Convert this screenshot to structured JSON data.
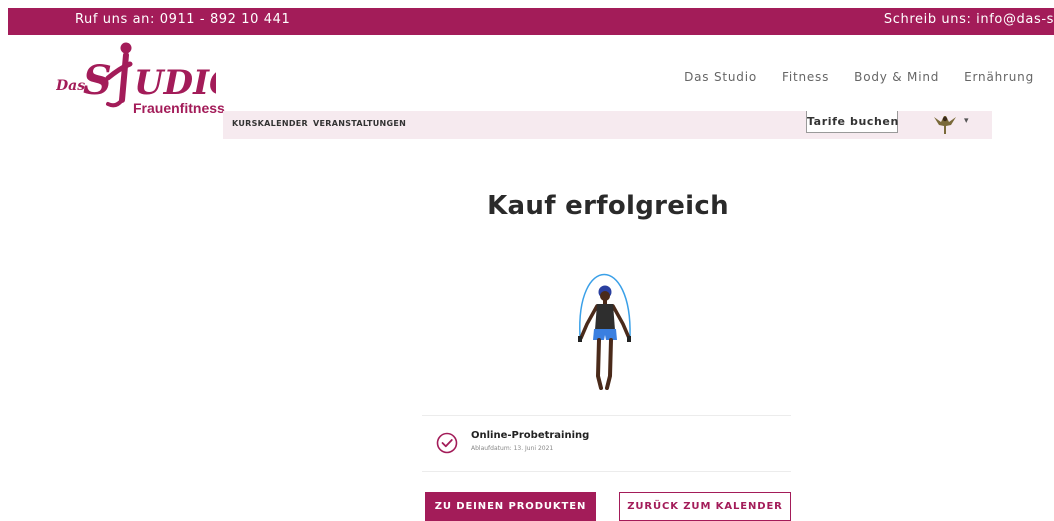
{
  "topbar": {
    "phone": "Ruf uns an: 0911 - 892 10 441",
    "email": "Schreib uns: info@das-s"
  },
  "logo": {
    "prefix": "Das",
    "name_s": "S",
    "name_rest": "UDIO",
    "subtitle": "Frauenfitness",
    "color": "#a31c59"
  },
  "main_nav": [
    "Das Studio",
    "Fitness",
    "Body & Mind",
    "Ernährung"
  ],
  "sub_nav": {
    "links": [
      "KURSKALENDER",
      "VERANSTALTUNGEN"
    ],
    "tarife_button": "Tarife buchen"
  },
  "page": {
    "title": "Kauf erfolgreich"
  },
  "product": {
    "name": "Online-Probetraining",
    "expiry": "Ablaufdatum: 13. Juni 2021"
  },
  "buttons": {
    "primary": "ZU DEINEN PRODUKTEN",
    "secondary": "ZURÜCK ZUM KALENDER"
  },
  "colors": {
    "brand": "#a31c59",
    "subbar_bg": "#f6eaef"
  },
  "icons": {
    "check": "check-circle-icon",
    "avatar": "user-avatar",
    "caret": "chevron-down-icon"
  }
}
